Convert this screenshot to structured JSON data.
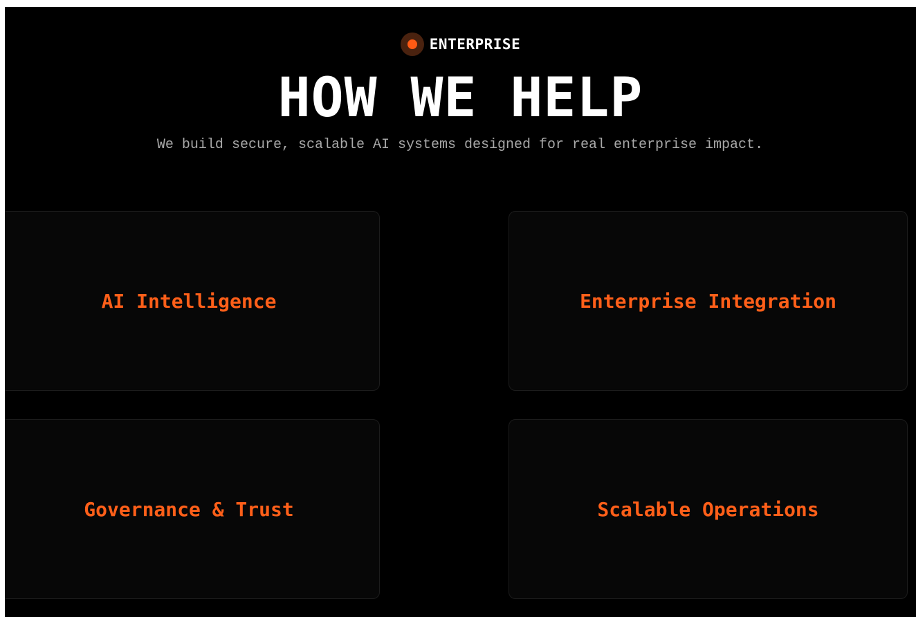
{
  "hero": {
    "eyebrow": "ENTERPRISE",
    "title": "HOW WE HELP",
    "subtitle": "We build secure, scalable AI systems designed for real enterprise impact."
  },
  "cards": [
    {
      "title": "AI Intelligence"
    },
    {
      "title": "Enterprise Integration"
    },
    {
      "title": "Governance & Trust"
    },
    {
      "title": "Scalable Operations"
    }
  ],
  "colors": {
    "background": "#000000",
    "accent": "#ff5f19",
    "card_background": "#070707",
    "title_text": "#ffffff",
    "subtitle_text": "#a8a8a8"
  }
}
